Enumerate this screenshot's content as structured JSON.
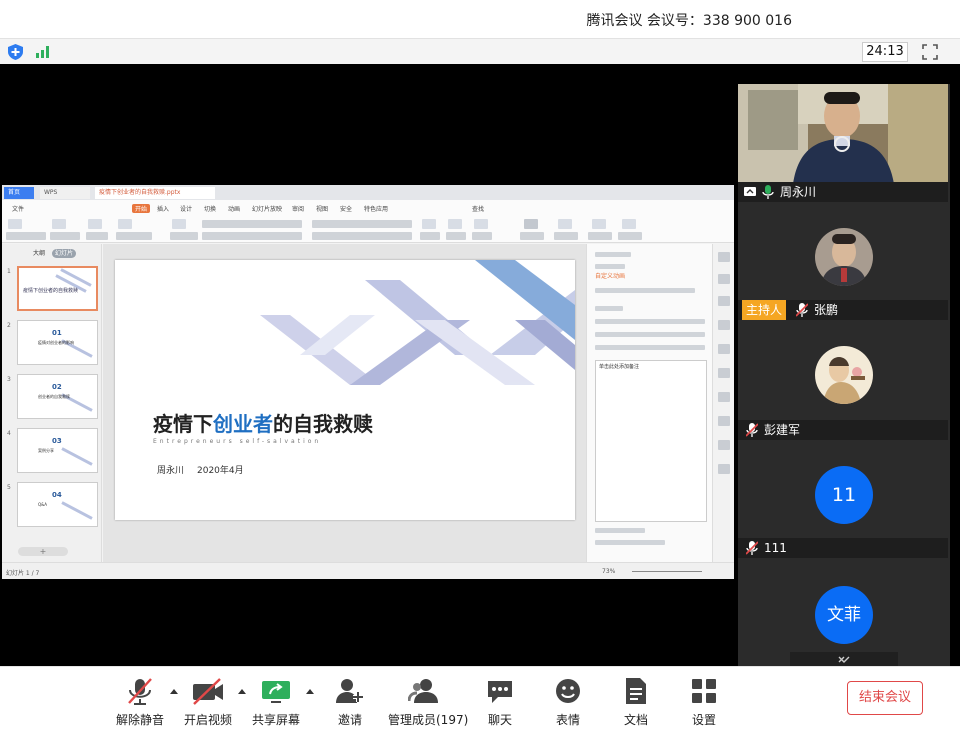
{
  "window": {
    "title": "腾讯会议  会议号：338 900 016",
    "timer": "24:13"
  },
  "shared": {
    "tabs": {
      "home": "首页",
      "wps": "WPS",
      "doc": "疫情下创业者的自我救赎.pptx"
    },
    "menu": [
      "文件",
      "开始",
      "插入",
      "设计",
      "切换",
      "动画",
      "幻灯片放映",
      "审阅",
      "视图",
      "安全",
      "特色应用",
      "查找"
    ],
    "menu_active_index": 1,
    "sidebar_tabs": [
      "大纲",
      "幻灯片"
    ],
    "thumbs": [
      {
        "num": "1",
        "big": "",
        "text": "疫情下创业者的自我救赎"
      },
      {
        "num": "2",
        "big": "01",
        "text": "疫情对创业者的影响"
      },
      {
        "num": "3",
        "big": "02",
        "text": "创业者的自我救赎"
      },
      {
        "num": "4",
        "big": "03",
        "text": "案例分享"
      },
      {
        "num": "5",
        "big": "04",
        "text": "Q&A"
      }
    ],
    "slide": {
      "title_a": "疫情下",
      "title_b": "创业者",
      "title_c": "的自我救赎",
      "subtitle": "Entrepreneurs self-salvation",
      "author": "周永川",
      "date": "2020年4月"
    },
    "rightpane": {
      "h1": "自定义动画",
      "notes": "单击此处添加备注"
    },
    "status": {
      "page": "幻灯片 1 / 7",
      "zoom": "73%"
    }
  },
  "participants": [
    {
      "name": "周永川",
      "host": false,
      "muted": false,
      "kind": "video"
    },
    {
      "name": "张鹏",
      "host": true,
      "host_label": "主持人",
      "muted": true,
      "kind": "photo"
    },
    {
      "name": "彭建军",
      "host": false,
      "muted": true,
      "kind": "photo"
    },
    {
      "name": "111",
      "host": false,
      "muted": true,
      "kind": "initials",
      "initials": "11"
    },
    {
      "name": "文菲",
      "host": false,
      "muted": true,
      "kind": "initials",
      "initials": "文菲"
    }
  ],
  "controls": {
    "unmute": "解除静音",
    "start_video": "开启视频",
    "share_screen": "共享屏幕",
    "invite": "邀请",
    "manage_members": "管理成员(197)",
    "chat": "聊天",
    "reaction": "表情",
    "document": "文档",
    "settings": "设置",
    "end_meeting": "结束会议"
  },
  "colors": {
    "accent_blue": "#0a6cf5",
    "host_orange": "#f5a623",
    "end_red": "#e04848",
    "share_green": "#2eaf5c"
  },
  "icons": [
    "shield-icon",
    "signal-icon",
    "fullscreen-icon",
    "mic-muted-icon",
    "video-off-icon",
    "share-screen-icon",
    "invite-icon",
    "members-icon",
    "chat-icon",
    "emoji-icon",
    "document-icon",
    "settings-icon"
  ]
}
